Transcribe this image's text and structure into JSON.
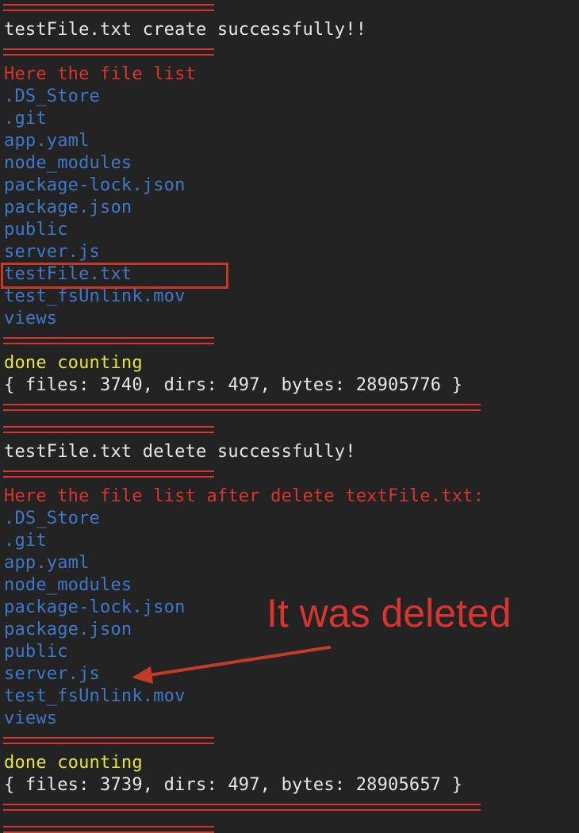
{
  "block1": {
    "status": "testFile.txt create successfully!!",
    "list_header": "Here the file list",
    "files": [
      ".DS_Store",
      ".git",
      "app.yaml",
      "node_modules",
      "package-lock.json",
      "package.json",
      "public",
      "server.js",
      "testFile.txt",
      "test_fsUnlink.mov",
      "views"
    ],
    "counting": "done counting",
    "stats": "{ files: 3740, dirs: 497, bytes: 28905776 }"
  },
  "block2": {
    "status": "testFile.txt delete successfully!",
    "list_header": "Here the file list after delete textFile.txt:",
    "files": [
      ".DS_Store",
      ".git",
      "app.yaml",
      "node_modules",
      "package-lock.json",
      "package.json",
      "public",
      "server.js",
      "test_fsUnlink.mov",
      "views"
    ],
    "counting": "done counting",
    "stats": "{ files: 3739, dirs: 497, bytes: 28905657 }"
  },
  "annotation": {
    "text": "It was deleted",
    "color": "#d9342d"
  },
  "colors": {
    "background": "#232323",
    "separator": "#d9342d",
    "status_text": "#e6e6e6",
    "header_text": "#d9342d",
    "file_text": "#3f78c9",
    "counting_text": "#e5e53a"
  }
}
